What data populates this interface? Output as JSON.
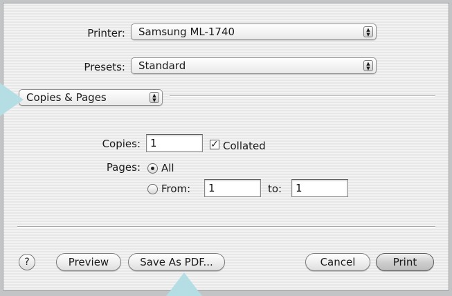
{
  "colors": {
    "pointer": "#b5dde4"
  },
  "printer": {
    "label": "Printer:",
    "value": "Samsung ML-1740"
  },
  "presets": {
    "label": "Presets:",
    "value": "Standard"
  },
  "section": {
    "value": "Copies & Pages"
  },
  "copies": {
    "label": "Copies:",
    "value": "1",
    "collated_label": "Collated",
    "collated_checked": true
  },
  "pages": {
    "label": "Pages:",
    "all_label": "All",
    "all_selected": true,
    "from_label": "From:",
    "from_value": "1",
    "to_label": "to:",
    "to_value": "1"
  },
  "buttons": {
    "help": "?",
    "preview": "Preview",
    "save_pdf": "Save As PDF...",
    "cancel": "Cancel",
    "print": "Print"
  },
  "icons": {
    "help": "question-mark-icon",
    "popup_arrows": "up-down-arrows-icon",
    "check": "checkmark-icon"
  }
}
